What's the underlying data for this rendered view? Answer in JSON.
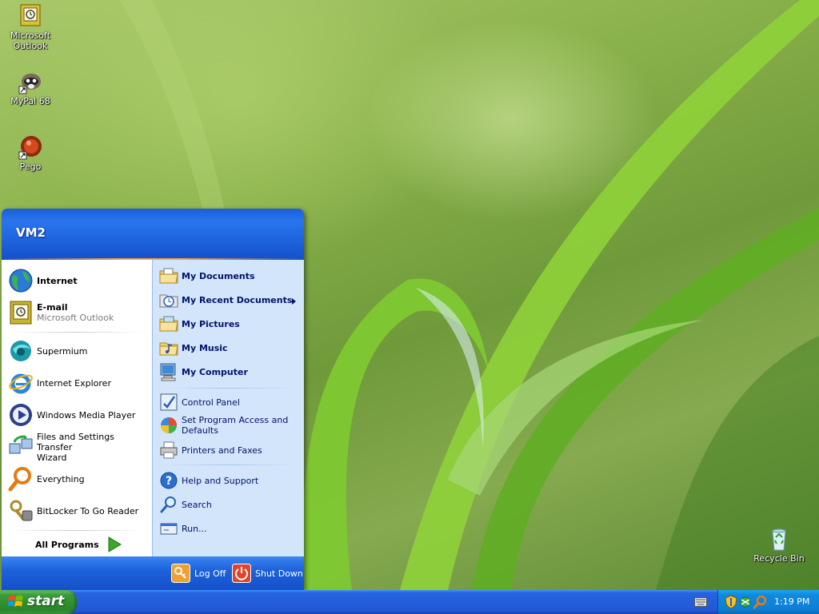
{
  "desktop": {
    "icons": [
      {
        "label": "Microsoft\nOutlook",
        "line1": "Microsoft",
        "line2": "Outlook",
        "icon": "outlook-icon"
      },
      {
        "label": "MyPal 68",
        "icon": "mypal-icon"
      },
      {
        "label": "Pego",
        "icon": "pego-icon"
      },
      {
        "label": "Recycle Bin",
        "icon": "recycle-bin-icon"
      }
    ]
  },
  "start_menu": {
    "user": "VM2",
    "pinned": [
      {
        "title": "Internet",
        "icon": "globe-icon"
      },
      {
        "title": "E-mail",
        "subtitle": "Microsoft Outlook",
        "icon": "outlook-icon"
      }
    ],
    "recent": [
      {
        "title": "Supermium",
        "icon": "supermium-icon"
      },
      {
        "title": "Internet Explorer",
        "icon": "ie-icon"
      },
      {
        "title": "Windows Media Player",
        "icon": "media-player-icon"
      },
      {
        "title": "Files and Settings Transfer",
        "title2": "Wizard",
        "icon": "transfer-wizard-icon"
      },
      {
        "title": "Everything",
        "icon": "everything-search-icon"
      },
      {
        "title": "BitLocker To Go Reader",
        "icon": "bitlocker-icon"
      }
    ],
    "all_programs": "All Programs",
    "places": [
      {
        "title": "My Documents",
        "icon": "folder-documents-icon"
      },
      {
        "title": "My Recent Documents",
        "icon": "recent-documents-icon"
      },
      {
        "title": "My Pictures",
        "icon": "folder-pictures-icon"
      },
      {
        "title": "My Music",
        "icon": "folder-music-icon"
      },
      {
        "title": "My Computer",
        "icon": "computer-icon"
      }
    ],
    "system": [
      {
        "title": "Control Panel",
        "icon": "control-panel-icon"
      },
      {
        "title": "Set Program Access and",
        "title2": "Defaults",
        "icon": "program-access-icon"
      },
      {
        "title": "Printers and Faxes",
        "icon": "printer-icon"
      }
    ],
    "help": [
      {
        "title": "Help and Support",
        "icon": "help-icon"
      },
      {
        "title": "Search",
        "icon": "search-icon"
      },
      {
        "title": "Run...",
        "icon": "run-icon"
      }
    ],
    "footer": {
      "logoff": "Log Off",
      "shutdown": "Shut Down"
    }
  },
  "taskbar": {
    "start_label": "start",
    "clock": "1:19 PM"
  },
  "colors": {
    "taskbar": "#245edb",
    "start_button": "#3c9c3c",
    "menu_header": "#1c5fd9"
  }
}
